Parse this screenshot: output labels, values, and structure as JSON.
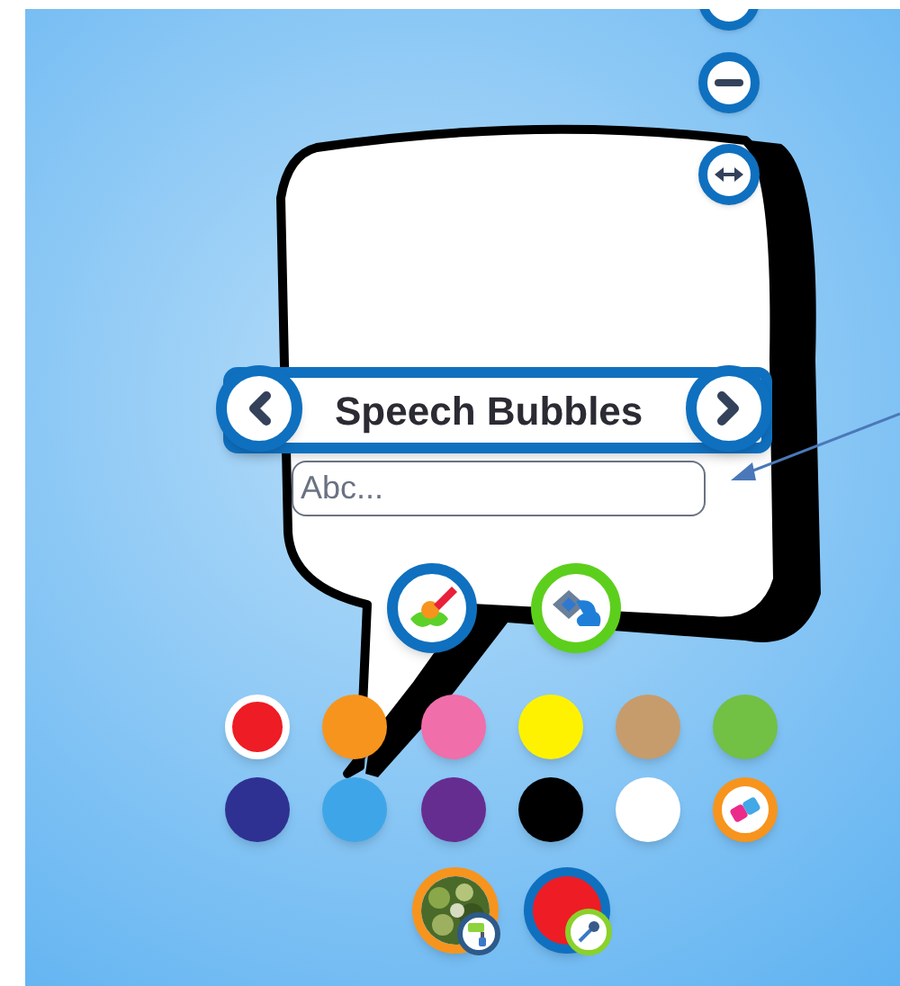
{
  "view_controls": [
    {
      "kind": "partial"
    },
    {
      "kind": "minus"
    },
    {
      "kind": "arrows"
    }
  ],
  "category": {
    "title": "Speech Bubbles"
  },
  "text_input": {
    "placeholder": "Abc..."
  },
  "tools": [
    {
      "kind": "brush",
      "selected": true
    },
    {
      "kind": "fill",
      "selected": false
    }
  ],
  "swatches": [
    {
      "color": "#ee1c24",
      "selected": true
    },
    {
      "color": "#f7941d",
      "selected": false
    },
    {
      "color": "#f06ea9",
      "selected": false
    },
    {
      "color": "#fff200",
      "selected": false
    },
    {
      "color": "#c69c6d",
      "selected": false
    },
    {
      "color": "#72c044",
      "selected": false
    },
    {
      "color": "#2e3192",
      "selected": false
    },
    {
      "color": "#3ea6e8",
      "selected": false
    },
    {
      "color": "#662d91",
      "selected": false
    },
    {
      "color": "#000000",
      "selected": false
    },
    {
      "color": "#ffffff",
      "selected": false
    },
    {
      "kind": "eraser"
    }
  ],
  "fill_sources": [
    {
      "kind": "texture"
    },
    {
      "kind": "color"
    }
  ]
}
